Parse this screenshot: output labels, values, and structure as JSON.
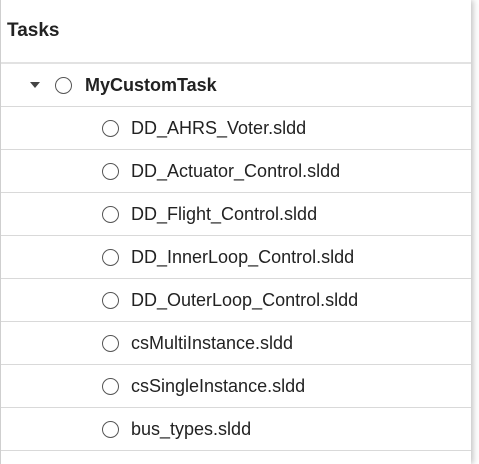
{
  "header": {
    "title": "Tasks"
  },
  "tree": {
    "parent": {
      "label": "MyCustomTask",
      "expand_icon": "caret-down-icon"
    },
    "children": [
      {
        "label": "DD_AHRS_Voter.sldd"
      },
      {
        "label": "DD_Actuator_Control.sldd"
      },
      {
        "label": "DD_Flight_Control.sldd"
      },
      {
        "label": "DD_InnerLoop_Control.sldd"
      },
      {
        "label": "DD_OuterLoop_Control.sldd"
      },
      {
        "label": "csMultiInstance.sldd"
      },
      {
        "label": "csSingleInstance.sldd"
      },
      {
        "label": "bus_types.sldd"
      }
    ]
  }
}
